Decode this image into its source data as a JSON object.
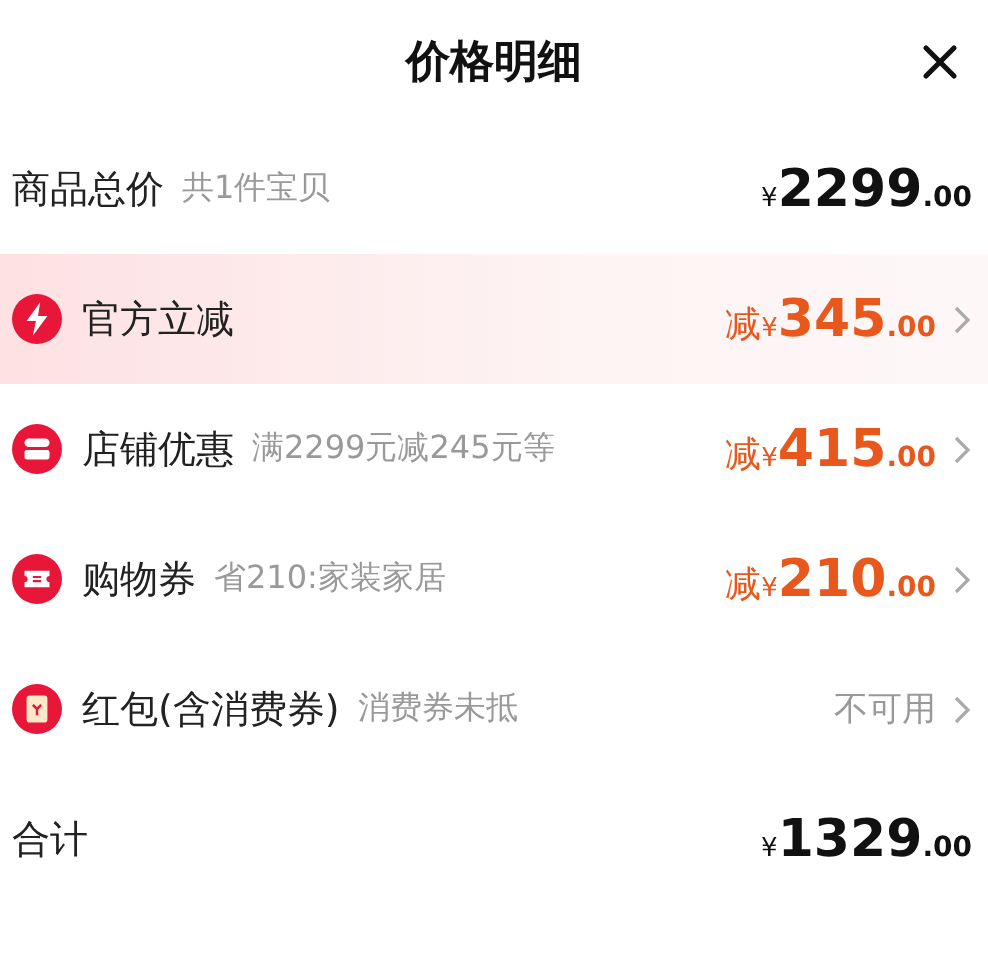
{
  "header": {
    "title": "价格明细"
  },
  "rows": [
    {
      "kind": "subtotal",
      "label": "商品总价",
      "note": "共1件宝贝",
      "highlighted": false,
      "amount": {
        "currency": "¥",
        "whole": "2299",
        "cents": ".00"
      }
    },
    {
      "kind": "discount",
      "label": "官方立减",
      "highlighted": true,
      "amount": {
        "prefix": "减",
        "currency": "¥",
        "whole": "345",
        "cents": ".00"
      }
    },
    {
      "kind": "discount",
      "label": "店铺优惠",
      "note": "满2299元减245元等",
      "highlighted": false,
      "amount": {
        "prefix": "减",
        "currency": "¥",
        "whole": "415",
        "cents": ".00"
      }
    },
    {
      "kind": "discount",
      "label": "购物券",
      "note": "省210:家装家居",
      "highlighted": false,
      "amount": {
        "prefix": "减",
        "currency": "¥",
        "whole": "210",
        "cents": ".00"
      }
    },
    {
      "kind": "unavailable",
      "label": "红包(含消费券)",
      "note": "消费券未抵",
      "highlighted": false,
      "status": "不可用"
    },
    {
      "kind": "total",
      "label": "合计",
      "highlighted": false,
      "amount": {
        "currency": "¥",
        "whole": "1329",
        "cents": ".00"
      }
    }
  ]
}
